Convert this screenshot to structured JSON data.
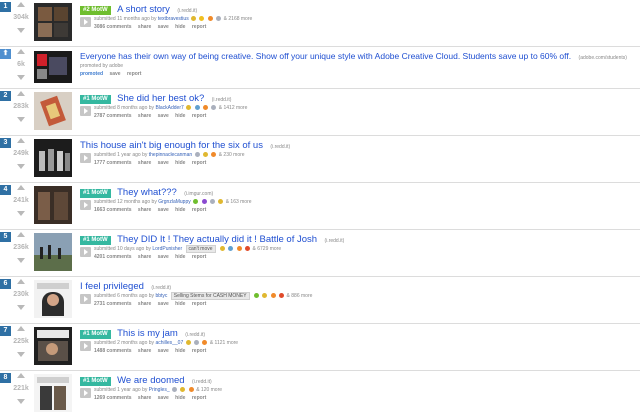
{
  "actions": {
    "comments_suffix": "comments",
    "share": "share",
    "save": "save",
    "hide": "hide",
    "report": "report"
  },
  "posts": [
    {
      "rank": "1",
      "score": "304k",
      "flair": "#2 MotW",
      "title": "A short story",
      "domain": "(i.redd.it)",
      "submitted": "submitted 11 months ago by",
      "author": "textbravestius",
      "awards_more": "& 2168 more",
      "comments": "3086 comments"
    },
    {
      "rank": "",
      "score": "6k",
      "title": "Everyone has their own way of being creative. Show off your unique style with Adobe Creative Cloud. Students save up to 60% off.",
      "domain": "(adobe.com/students)",
      "submitted": "promoted by adobe",
      "promoted": "promoted",
      "save": "save",
      "report": "report"
    },
    {
      "rank": "2",
      "score": "283k",
      "flair": "#1 MotW",
      "title": "She did her best ok?",
      "domain": "(i.redd.it)",
      "submitted": "submitted 8 months ago by",
      "author": "BlackAdder7",
      "awards_more": "& 1412 more",
      "comments": "2787 comments"
    },
    {
      "rank": "3",
      "score": "249k",
      "title": "This house ain't big enough for the six of us",
      "domain": "(i.redd.it)",
      "submitted": "submitted 1 year ago by",
      "author": "thepinnaclecanman",
      "awards_more": "& 230 more",
      "comments": "1777 comments"
    },
    {
      "rank": "4",
      "score": "241k",
      "flair": "#1 MotW",
      "title": "They what???",
      "domain": "(i.imgur.com)",
      "submitted": "submitted 12 months ago by",
      "author": "GrgnzlaMuppy",
      "awards_more": "& 163 more",
      "comments": "1663 comments"
    },
    {
      "rank": "5",
      "score": "236k",
      "flair": "#1 MotW",
      "title": "They DID It ! They actually did it ! Battle of Josh",
      "domain": "(i.redd.it)",
      "submitted": "submitted 10 days ago by",
      "author": "LordPunisher",
      "user_flair": "can't move",
      "awards_more": "& 6729 more",
      "comments": "4201 comments"
    },
    {
      "rank": "6",
      "score": "230k",
      "title": "I feel privileged",
      "domain": "(i.redd.it)",
      "submitted": "submitted 6 months ago by",
      "author": "bbtyc",
      "user_flair": "Selling Stems for CASH MONEY",
      "awards_more": "& 886 more",
      "comments": "2731 comments"
    },
    {
      "rank": "7",
      "score": "225k",
      "flair": "#1 MotW",
      "title": "This is my jam",
      "domain": "(i.redd.it)",
      "submitted": "submitted 2 months ago by",
      "author": "achilles__07",
      "awards_more": "& 1121 more",
      "comments": "1488 comments"
    },
    {
      "rank": "8",
      "score": "221k",
      "flair": "#1 MotW",
      "title": "We are doomed",
      "domain": "(i.redd.it)",
      "submitted": "submitted 1 year ago by",
      "author": "Pringles_",
      "awards_more": "& 120 more",
      "comments": "1269 comments"
    }
  ],
  "colors": {
    "link": "#1f4fd1",
    "flair": "#35b8a0",
    "rank": "#2f70a4"
  }
}
